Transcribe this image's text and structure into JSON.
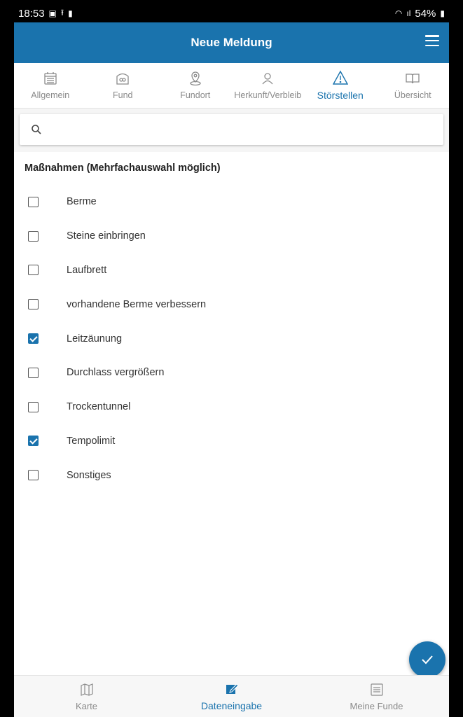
{
  "statusbar": {
    "time": "18:53",
    "battery": "54%"
  },
  "appbar": {
    "title": "Neue Meldung",
    "menu_icon": "hamburger-menu-icon"
  },
  "tabs": [
    {
      "label": "Allgemein",
      "icon": "calendar-icon",
      "active": false
    },
    {
      "label": "Fund",
      "icon": "cage-icon",
      "active": false
    },
    {
      "label": "Fundort",
      "icon": "location-pin-icon",
      "active": false
    },
    {
      "label": "Herkunft/Verbleib",
      "icon": "person-icon",
      "active": false
    },
    {
      "label": "Störstellen",
      "icon": "warning-icon",
      "active": true
    },
    {
      "label": "Übersicht",
      "icon": "book-icon",
      "active": false
    }
  ],
  "search": {
    "value": "",
    "placeholder": ""
  },
  "section_title": "Maßnahmen (Mehrfachauswahl möglich)",
  "options": [
    {
      "label": "Berme",
      "checked": false
    },
    {
      "label": "Steine einbringen",
      "checked": false
    },
    {
      "label": "Laufbrett",
      "checked": false
    },
    {
      "label": "vorhandene Berme verbessern",
      "checked": false
    },
    {
      "label": "Leitzäunung",
      "checked": true
    },
    {
      "label": "Durchlass vergrößern",
      "checked": false
    },
    {
      "label": "Trockentunnel",
      "checked": false
    },
    {
      "label": "Tempolimit",
      "checked": true
    },
    {
      "label": "Sonstiges",
      "checked": false
    }
  ],
  "bottomnav": [
    {
      "label": "Karte",
      "icon": "map-icon",
      "active": false
    },
    {
      "label": "Dateneingabe",
      "icon": "edit-icon",
      "active": true
    },
    {
      "label": "Meine Funde",
      "icon": "list-icon",
      "active": false
    }
  ],
  "colors": {
    "accent": "#1a73ad",
    "inactive": "#8a8a8a"
  }
}
